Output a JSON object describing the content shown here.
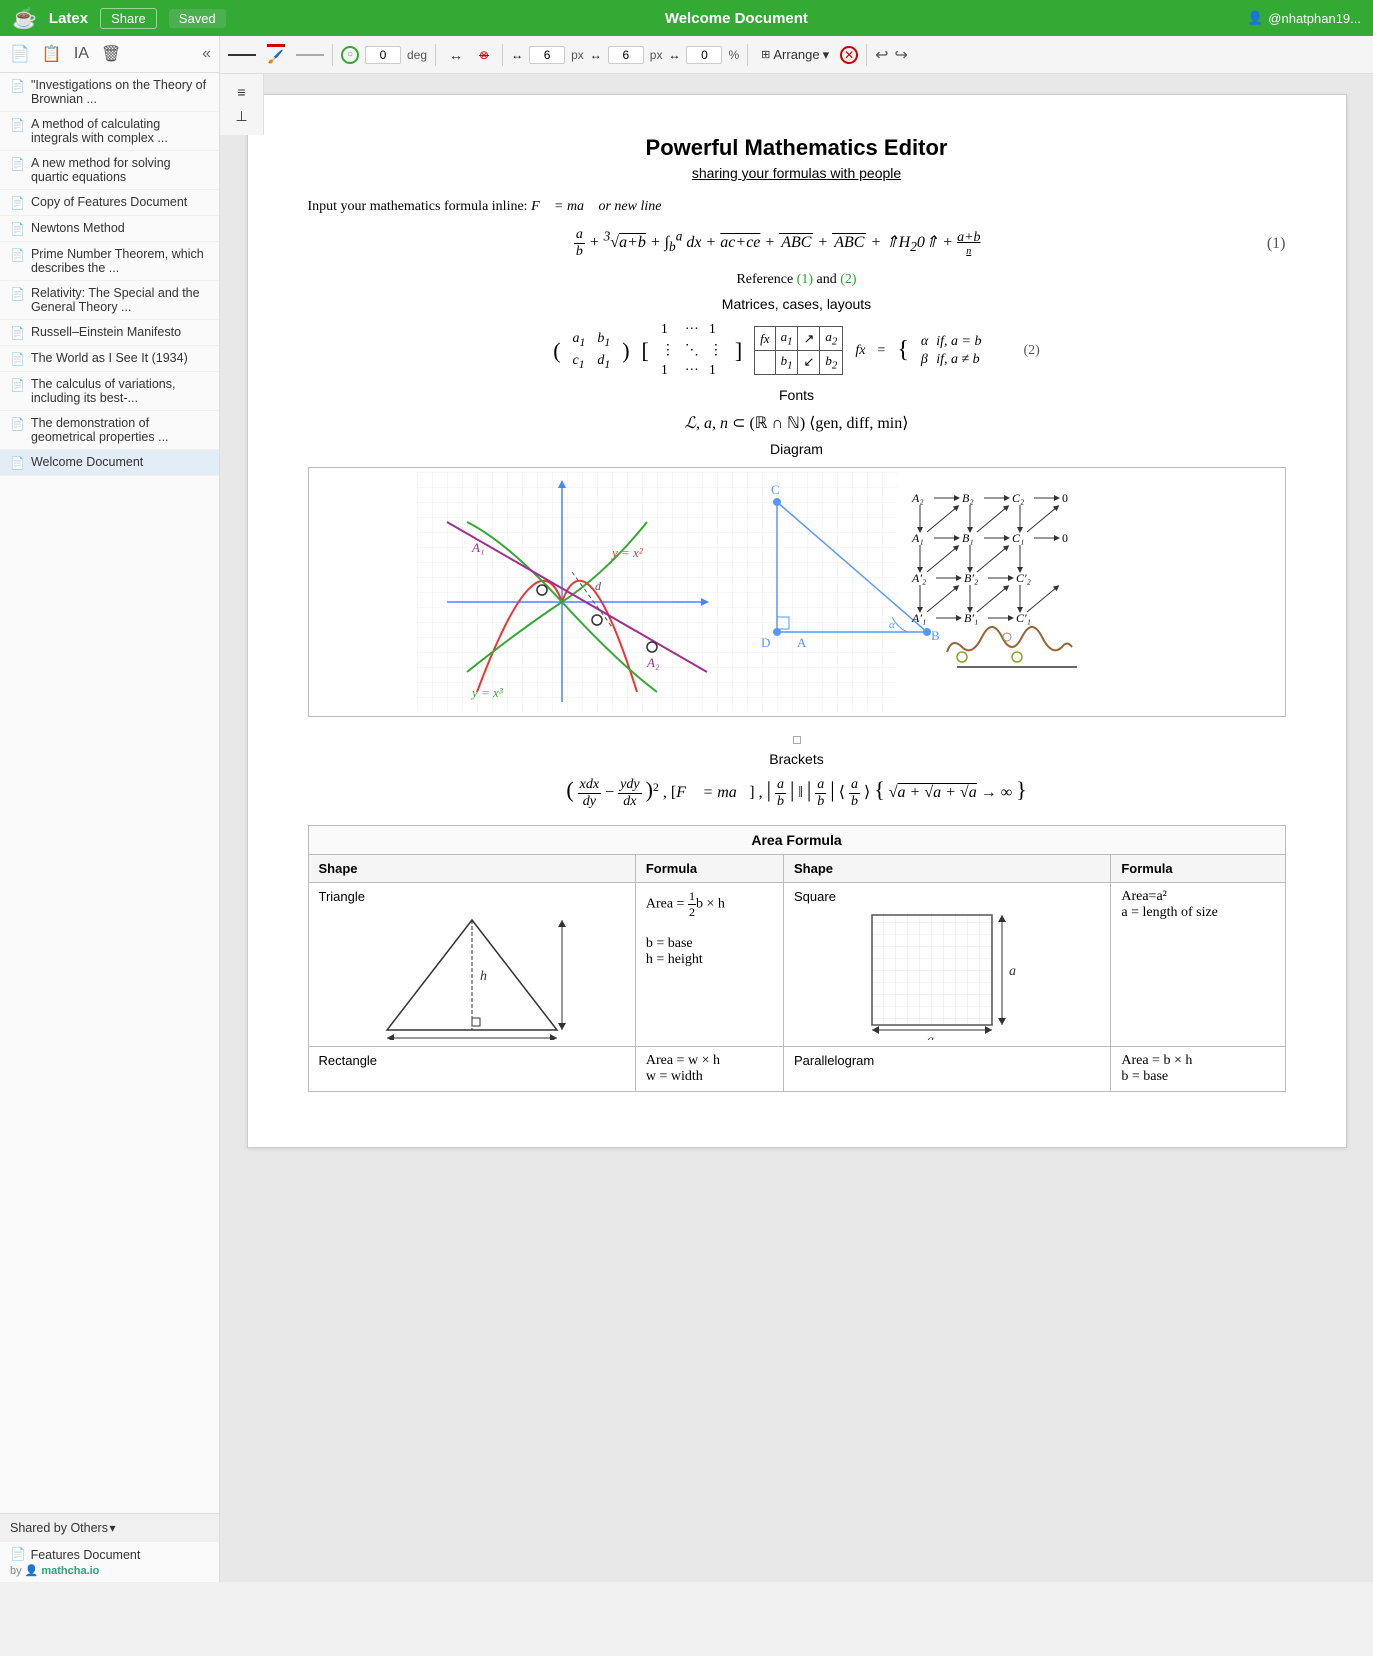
{
  "topbar": {
    "logo": "☕",
    "app_name": "Latex",
    "share_label": "Share",
    "saved_label": "Saved",
    "doc_title": "Welcome Document",
    "user": "@nhatphan19..."
  },
  "toolbar": {
    "angle_value": "0",
    "angle_unit": "deg",
    "width1": "6",
    "width2": "6",
    "percent": "0",
    "arrange_label": "Arrange",
    "undo_icon": "↩",
    "redo_icon": "↪"
  },
  "sidebar": {
    "items": [
      {
        "label": "\"Investigations on the Theory of Brownian ...",
        "id": "doc-1"
      },
      {
        "label": "A method of calculating integrals with complex ...",
        "id": "doc-2"
      },
      {
        "label": "A new method for solving quartic equations",
        "id": "doc-3"
      },
      {
        "label": "Copy of Features Document",
        "id": "doc-4"
      },
      {
        "label": "Newtons Method",
        "id": "doc-5"
      },
      {
        "label": "Prime Number Theorem, which describes the ...",
        "id": "doc-6"
      },
      {
        "label": "Relativity: The Special and the General Theory ...",
        "id": "doc-7"
      },
      {
        "label": "Russell–Einstein Manifesto",
        "id": "doc-8"
      },
      {
        "label": "The World as I See It (1934)",
        "id": "doc-9"
      },
      {
        "label": "The calculus of variations, including its best-...",
        "id": "doc-10"
      },
      {
        "label": "The demonstration of geometrical properties ...",
        "id": "doc-11"
      },
      {
        "label": "Welcome Document",
        "id": "doc-12",
        "active": true
      }
    ],
    "shared_section_label": "Shared by Others",
    "shared_items": [
      {
        "title": "Features Document",
        "shared_by_label": "by",
        "author": "mathcha.io",
        "icon": "👤"
      }
    ]
  },
  "doc": {
    "title": "Powerful Mathematics Editor",
    "subtitle": "sharing your formulas with people",
    "inline_text": "Input your mathematics formula inline:",
    "sections": {
      "matrices_label": "Matrices, cases, layouts",
      "fonts_label": "Fonts",
      "diagram_label": "Diagram",
      "brackets_label": "Brackets",
      "area_formula_label": "Area Formula"
    },
    "ref_text": "Reference (1) and (2)",
    "area_table": {
      "headers": [
        "Shape",
        "Formula",
        "Shape",
        "Formula"
      ],
      "rows": [
        {
          "shape1": "Triangle",
          "formula1": "Area = ½b × h\nb = base\nh = height",
          "shape2": "Square",
          "formula2": "Area=a²\na = length of size"
        },
        {
          "shape1": "Rectangle",
          "formula1": "Area = w × h\nw = width",
          "shape2": "Parallelogram",
          "formula2": "Area = b × h\nb = base"
        }
      ]
    }
  }
}
